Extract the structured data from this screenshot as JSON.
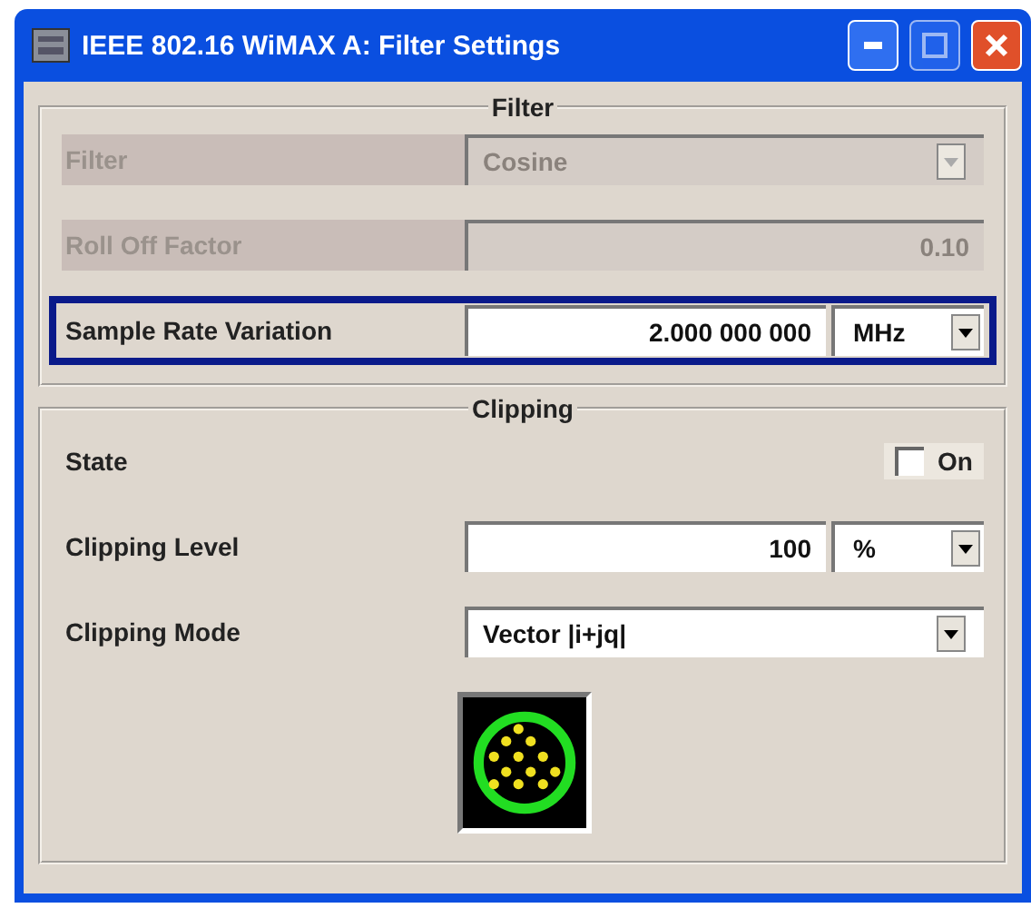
{
  "window": {
    "title": "IEEE 802.16 WiMAX A: Filter Settings"
  },
  "groups": [
    {
      "title": "Filter",
      "rows": [
        {
          "kind": "select",
          "label": "Filter",
          "value": "Cosine",
          "disabled": true,
          "focused": false
        },
        {
          "kind": "number",
          "label": "Roll Off Factor",
          "value": "0.10",
          "disabled": true,
          "focused": false
        },
        {
          "kind": "number_unit",
          "label": "Sample Rate Variation",
          "value": "2.000 000 000",
          "unit": "MHz",
          "disabled": false,
          "focused": true
        }
      ]
    },
    {
      "title": "Clipping",
      "rows": [
        {
          "kind": "checkbox",
          "label": "State",
          "option": "On",
          "checked": false,
          "disabled": false,
          "focused": false
        },
        {
          "kind": "number_unit",
          "label": "Clipping Level",
          "value": "100",
          "unit": "%",
          "disabled": false,
          "focused": false
        },
        {
          "kind": "select",
          "label": "Clipping Mode",
          "value": "Vector |i+jq|",
          "disabled": false,
          "focused": false
        },
        {
          "kind": "constellation"
        }
      ]
    }
  ]
}
